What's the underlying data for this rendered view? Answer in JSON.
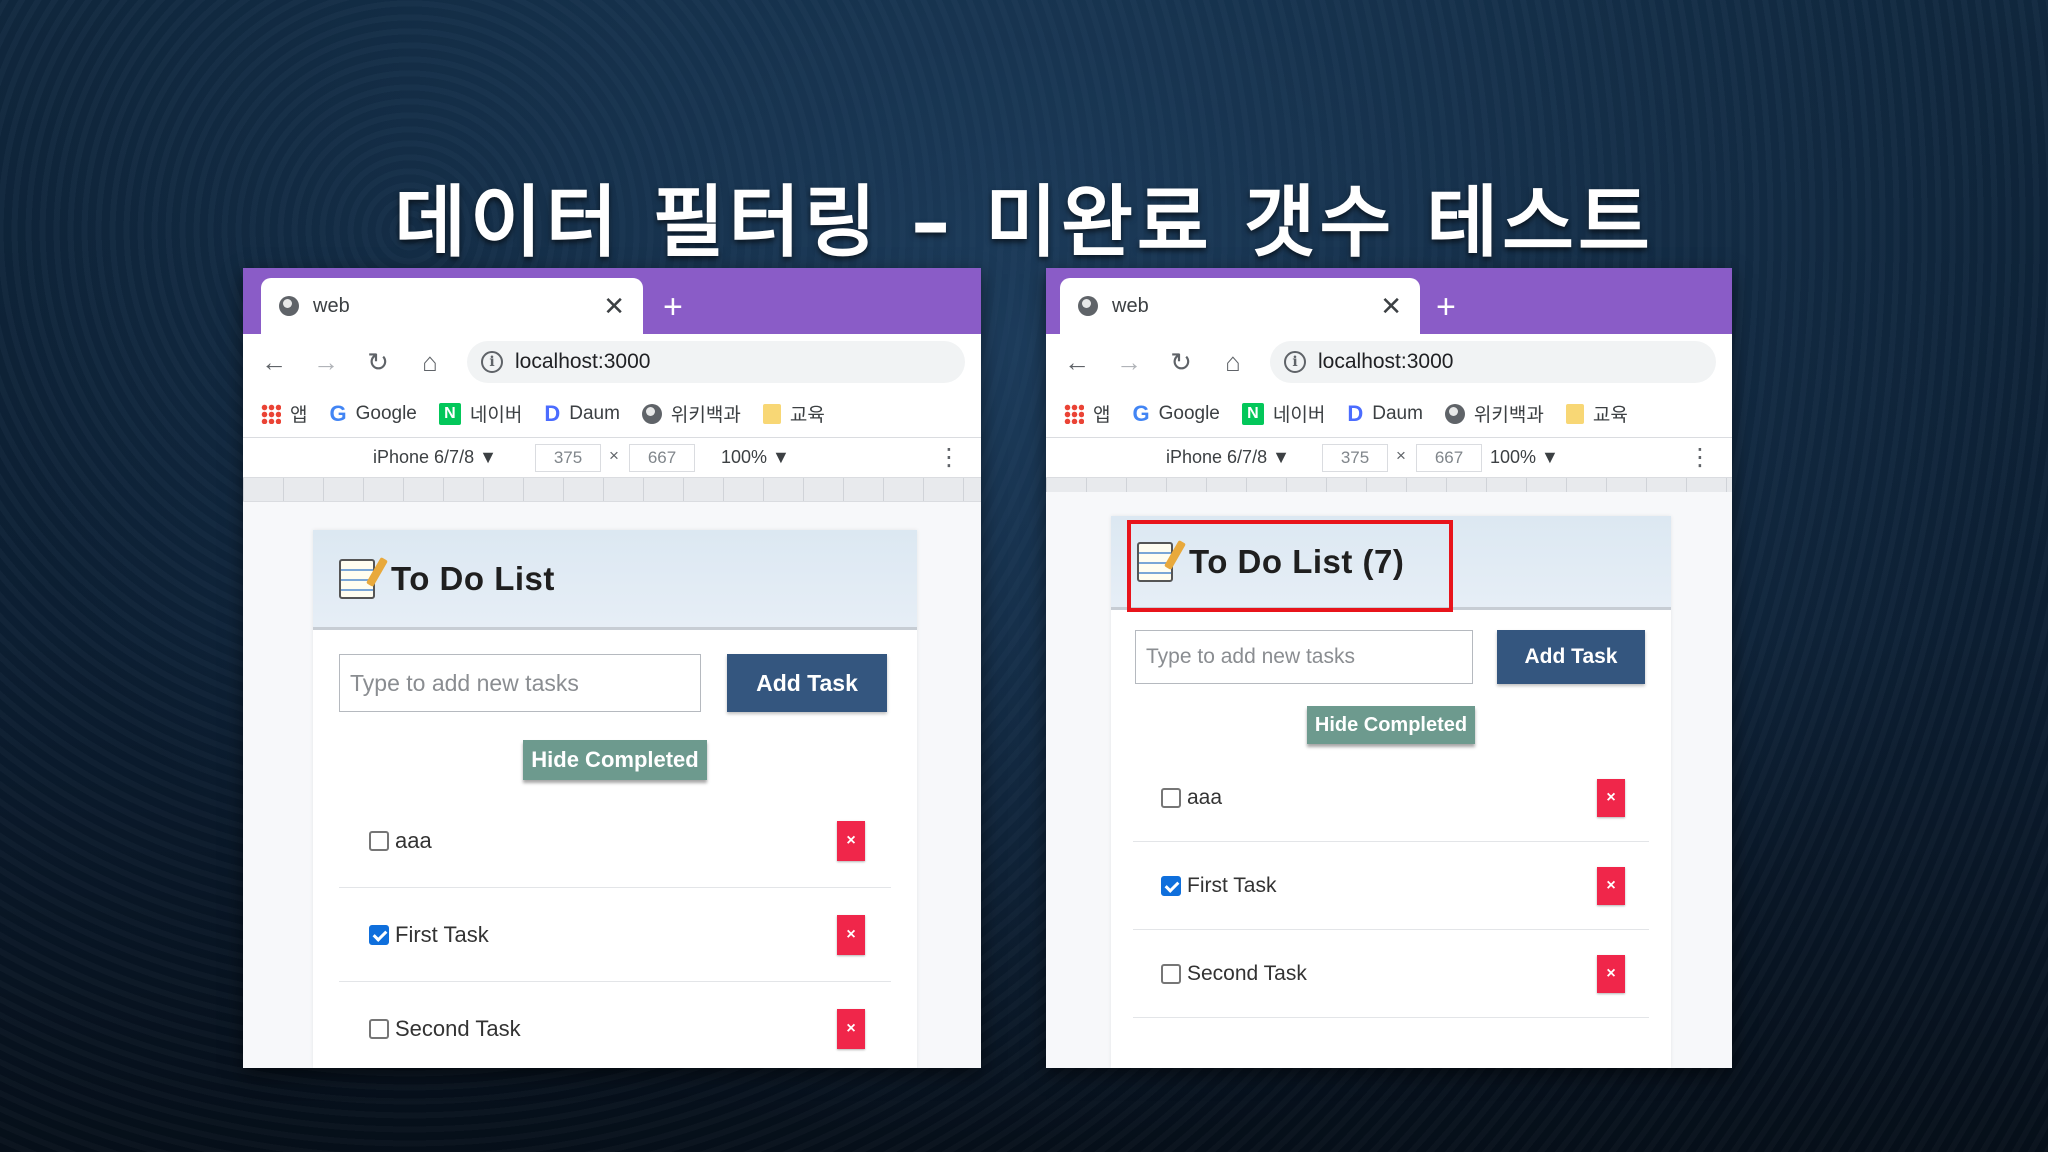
{
  "slide": {
    "title": "데이터 필터링 – 미완료 갯수 테스트"
  },
  "browsers": [
    {
      "tab_title": "web",
      "tab_close": "✕",
      "new_tab": "+",
      "url": "localhost:3000",
      "bookmarks": [
        "앱",
        "Google",
        "네이버",
        "Daum",
        "위키백과",
        "교육"
      ],
      "device": "iPhone 6/7/8 ▼",
      "width": "375",
      "times": "×",
      "height": "667",
      "zoom": "100% ▼",
      "app_title": "To Do List",
      "input_placeholder": "Type to add new tasks",
      "add_label": "Add Task",
      "hide_label": "Hide Completed",
      "tasks": [
        {
          "label": "aaa",
          "checked": false
        },
        {
          "label": "First Task",
          "checked": true
        },
        {
          "label": "Second Task",
          "checked": false
        }
      ],
      "delete_label": "×"
    },
    {
      "tab_title": "web",
      "tab_close": "✕",
      "new_tab": "+",
      "url": "localhost:3000",
      "bookmarks": [
        "앱",
        "Google",
        "네이버",
        "Daum",
        "위키백과",
        "교육"
      ],
      "device": "iPhone 6/7/8 ▼",
      "width": "375",
      "times": "×",
      "height": "667",
      "zoom": "100% ▼",
      "app_title": "To Do List (7)",
      "input_placeholder": "Type to add new tasks",
      "add_label": "Add Task",
      "hide_label": "Hide Completed",
      "tasks": [
        {
          "label": "aaa",
          "checked": false
        },
        {
          "label": "First Task",
          "checked": true
        },
        {
          "label": "Second Task",
          "checked": false
        }
      ],
      "delete_label": "×"
    }
  ],
  "colors": {
    "tabstrip": "#8a5cc7",
    "header": "#dce8f2",
    "add_button": "#34567f",
    "hide_button": "#6d9a8e",
    "delete_button": "#f0264a",
    "highlight": "#e8141b",
    "checkbox_checked": "#0f6fdc"
  },
  "icons": {
    "tab": "globe-icon",
    "nav": [
      "back-arrow-icon",
      "forward-arrow-icon",
      "reload-icon",
      "home-icon"
    ],
    "omnibox": "info-icon",
    "app": "memo-icon",
    "menu": "kebab-menu-icon"
  }
}
